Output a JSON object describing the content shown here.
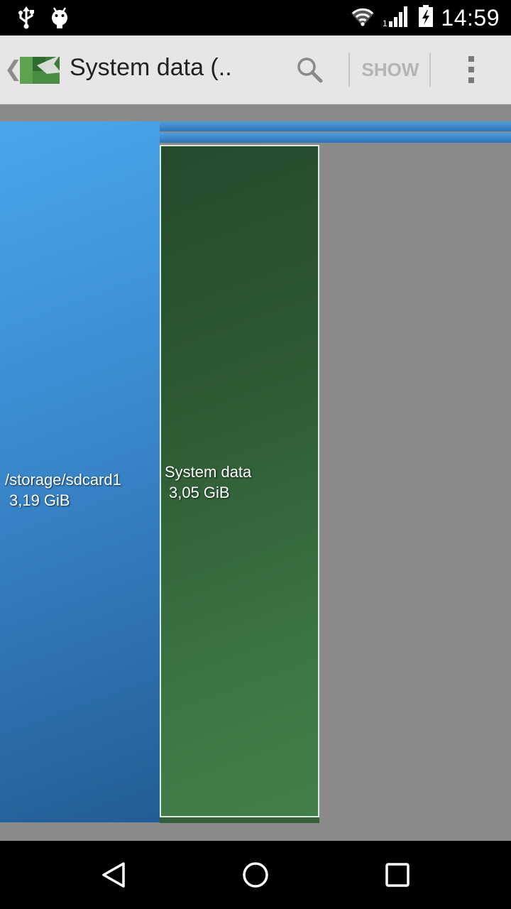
{
  "status_bar": {
    "time": "14:59",
    "left_icons": [
      "usb-icon",
      "android-debug-icon"
    ],
    "right_icons": [
      "wifi-icon",
      "cell-signal-icon",
      "battery-charging-icon"
    ]
  },
  "action_bar": {
    "title": "System data (..",
    "show_label": "SHOW",
    "icons": {
      "up": "up-caret-icon",
      "logo": "app-logo-icon",
      "search": "search-icon",
      "overflow": "overflow-menu-icon"
    }
  },
  "treemap": {
    "tiles": [
      {
        "name": "/storage/sdcard1",
        "size": "3,19 GiB",
        "color": "#3a88cc"
      },
      {
        "name": "System data",
        "size": "3,05 GiB",
        "color": "#2f5b35",
        "selected": true
      }
    ]
  },
  "nav_bar": {
    "icons": [
      "back-icon",
      "home-icon",
      "recents-icon"
    ]
  },
  "colors": {
    "status_bar_bg": "#000000",
    "action_bar_bg": "#e6e6e6",
    "content_bg": "#8a8a8a",
    "blue_tile": "#3a88cc",
    "green_tile": "#2f5b35"
  }
}
